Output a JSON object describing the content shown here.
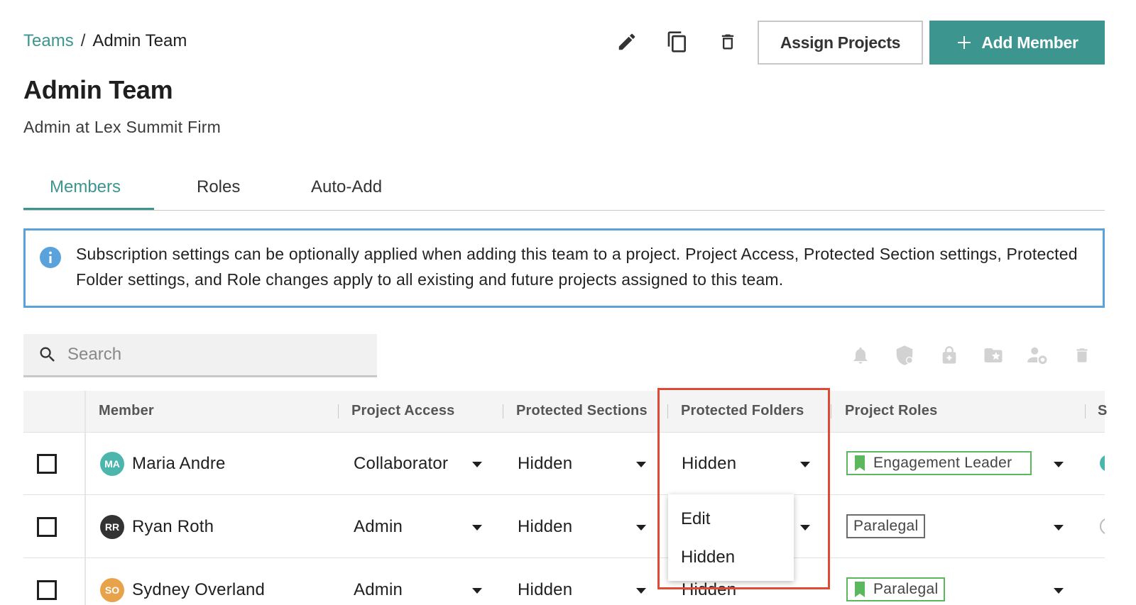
{
  "breadcrumb": {
    "parent": "Teams",
    "separator": "/",
    "current": "Admin Team"
  },
  "page": {
    "title": "Admin Team",
    "subtitle": "Admin at Lex Summit Firm"
  },
  "header_actions": {
    "assign_projects": "Assign Projects",
    "add_member": "Add Member"
  },
  "tabs": [
    {
      "label": "Members",
      "active": true
    },
    {
      "label": "Roles",
      "active": false
    },
    {
      "label": "Auto-Add",
      "active": false
    }
  ],
  "banner": {
    "text": "Subscription settings can be optionally applied when adding this team to a project. Project Access, Protected Section settings, Protected Folder settings, and Role changes apply to all existing and future projects assigned to this team."
  },
  "search": {
    "placeholder": "Search",
    "value": ""
  },
  "toolbar_icons": [
    "bell-icon",
    "shield-icon",
    "lock-icon",
    "folder-star-icon",
    "user-gear-icon",
    "trash-icon"
  ],
  "table": {
    "columns": [
      "Member",
      "Project Access",
      "Protected Sections",
      "Protected Folders",
      "Project Roles",
      "S"
    ],
    "rows": [
      {
        "initials": "MA",
        "avatar_color": "#4db6ac",
        "name": "Maria Andre",
        "access": "Collaborator",
        "sections": "Hidden",
        "folders": "Hidden",
        "role": "Engagement Leader",
        "role_flag": true
      },
      {
        "initials": "RR",
        "avatar_color": "#333333",
        "name": "Ryan Roth",
        "access": "Admin",
        "sections": "Hidden",
        "folders": "Hidden",
        "role": "Paralegal",
        "role_flag": false
      },
      {
        "initials": "SO",
        "avatar_color": "#e8a24a",
        "name": "Sydney Overland",
        "access": "Admin",
        "sections": "Hidden",
        "folders": "Hidden",
        "role": "Paralegal",
        "role_flag": true
      }
    ]
  },
  "folders_dropdown": {
    "options": [
      "Edit",
      "Hidden"
    ]
  },
  "colors": {
    "accent": "#3d9590",
    "info": "#5aa2dc",
    "highlight": "#e04a35",
    "tag_green": "#5cb85c"
  }
}
